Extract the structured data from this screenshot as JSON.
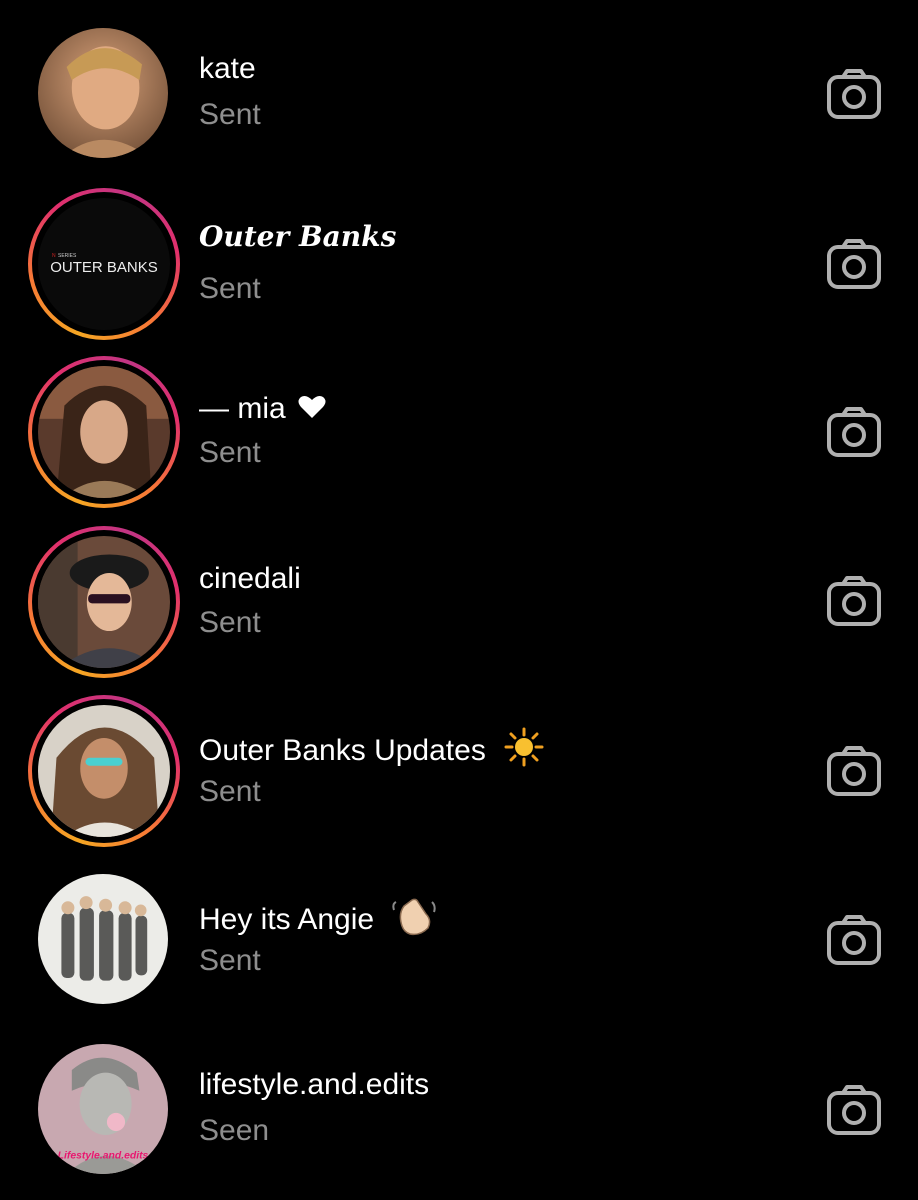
{
  "conversations": [
    {
      "name": "kate",
      "status": "Sent",
      "has_story_ring": false,
      "avatar": "photo-young-man-blonde",
      "action_icon": "camera-icon"
    },
    {
      "name": "Outer Banks",
      "status": "Sent",
      "has_story_ring": true,
      "avatar": "logo-outer-banks",
      "avatar_text": "OUTER BANKS",
      "avatar_small_text": "SERIES",
      "action_icon": "camera-icon"
    },
    {
      "name": "— mia",
      "name_suffix": "♥",
      "status": "Sent",
      "has_story_ring": true,
      "avatar": "photo-woman-brunette",
      "action_icon": "camera-icon"
    },
    {
      "name": "cinedali",
      "status": "Sent",
      "has_story_ring": true,
      "avatar": "photo-woman-beret-sunglasses",
      "action_icon": "camera-icon"
    },
    {
      "name": "Outer Banks Updates",
      "name_suffix": "☀",
      "status": "Sent",
      "has_story_ring": true,
      "avatar": "photo-woman-curly-hair",
      "action_icon": "camera-icon"
    },
    {
      "name": "Hey its Angie",
      "name_suffix": "👋",
      "status": "Sent",
      "has_story_ring": false,
      "avatar": "photo-group-cast",
      "action_icon": "camera-icon"
    },
    {
      "name": "lifestyle.and.edits",
      "status": "Seen",
      "has_story_ring": false,
      "avatar": "photo-statue-bubblegum",
      "avatar_text": "Lifestyle.and.edits",
      "action_icon": "camera-icon"
    }
  ],
  "colors": {
    "background": "#000000",
    "primary_text": "#ffffff",
    "secondary_text": "#8e8e8e",
    "icon": "#b0b0b0",
    "story_ring_start": "#f5a623",
    "story_ring_end": "#c13584"
  }
}
